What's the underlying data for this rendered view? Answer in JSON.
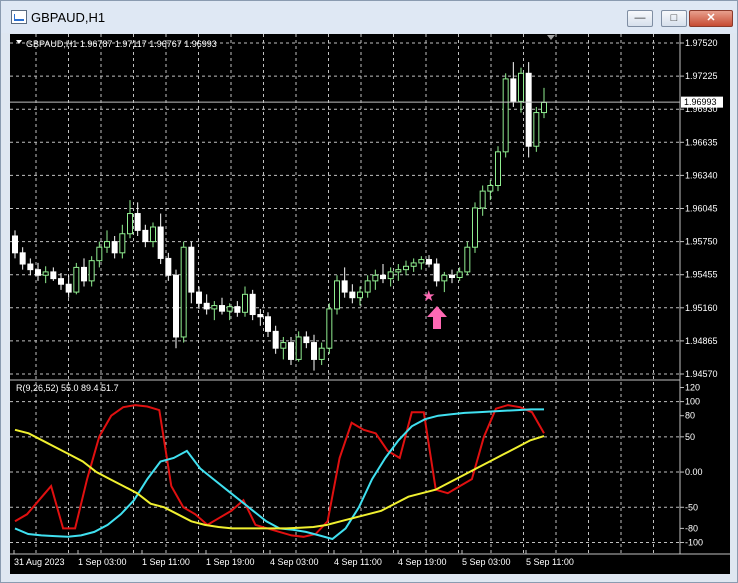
{
  "window": {
    "title": "GBPAUD,H1",
    "minimize_icon": "minimize-icon",
    "maximize_icon": "maximize-icon",
    "close_icon": "close-icon"
  },
  "info": {
    "header": "GBPAUD,H1  1.96787 1.97117 1.96767 1.96993",
    "indicator": "R(9,26,52) 55.0 89.4 51.7",
    "current_price": "1.96993"
  },
  "colors": {
    "background": "#000000",
    "grid": "#c0c0c0",
    "bull": "#90ee90",
    "bear": "#ffffff",
    "red_line": "#e01010",
    "cyan_line": "#40e0f0",
    "yellow_line": "#f0f030",
    "marker": "#ff69b4"
  },
  "chart_data": [
    {
      "type": "candlestick",
      "symbol": "GBPAUD",
      "timeframe": "H1",
      "y_ticks": [
        "1.97520",
        "1.97225",
        "1.96930",
        "1.96635",
        "1.96340",
        "1.96045",
        "1.95750",
        "1.95455",
        "1.95160",
        "1.94865",
        "1.94570"
      ],
      "ylim": [
        1.9457,
        1.9752
      ],
      "x_ticks": [
        "31 Aug 2023",
        "1 Sep 03:00",
        "1 Sep 11:00",
        "1 Sep 19:00",
        "4 Sep 03:00",
        "4 Sep 11:00",
        "4 Sep 19:00",
        "5 Sep 03:00",
        "5 Sep 11:00"
      ],
      "candles": [
        [
          1.958,
          1.9585,
          1.956,
          1.9565
        ],
        [
          1.9565,
          1.957,
          1.955,
          1.9555
        ],
        [
          1.9555,
          1.956,
          1.9545,
          1.955
        ],
        [
          1.955,
          1.9556,
          1.954,
          1.9545
        ],
        [
          1.9545,
          1.9553,
          1.9538,
          1.9548
        ],
        [
          1.9548,
          1.9552,
          1.954,
          1.9542
        ],
        [
          1.9542,
          1.9547,
          1.9532,
          1.9537
        ],
        [
          1.9537,
          1.9545,
          1.9525,
          1.953
        ],
        [
          1.953,
          1.9556,
          1.9528,
          1.9552
        ],
        [
          1.9552,
          1.956,
          1.9535,
          1.954
        ],
        [
          1.954,
          1.9562,
          1.9535,
          1.9558
        ],
        [
          1.9558,
          1.9575,
          1.9552,
          1.957
        ],
        [
          1.957,
          1.9585,
          1.9565,
          1.9575
        ],
        [
          1.9575,
          1.958,
          1.956,
          1.9565
        ],
        [
          1.9565,
          1.959,
          1.956,
          1.9582
        ],
        [
          1.9582,
          1.9612,
          1.9578,
          1.96
        ],
        [
          1.96,
          1.961,
          1.958,
          1.9585
        ],
        [
          1.9585,
          1.959,
          1.957,
          1.9575
        ],
        [
          1.9575,
          1.9592,
          1.957,
          1.9588
        ],
        [
          1.9588,
          1.96,
          1.9555,
          1.956
        ],
        [
          1.956,
          1.9565,
          1.954,
          1.9545
        ],
        [
          1.9545,
          1.955,
          1.948,
          1.949
        ],
        [
          1.949,
          1.9575,
          1.9485,
          1.957
        ],
        [
          1.957,
          1.9575,
          1.952,
          1.953
        ],
        [
          1.953,
          1.9535,
          1.9515,
          1.952
        ],
        [
          1.952,
          1.9528,
          1.951,
          1.9515
        ],
        [
          1.9515,
          1.9522,
          1.9505,
          1.9518
        ],
        [
          1.9518,
          1.9525,
          1.951,
          1.9513
        ],
        [
          1.9513,
          1.952,
          1.9505,
          1.9517
        ],
        [
          1.9517,
          1.9522,
          1.9508,
          1.9512
        ],
        [
          1.9512,
          1.9535,
          1.9508,
          1.9528
        ],
        [
          1.9528,
          1.9532,
          1.9505,
          1.951
        ],
        [
          1.951,
          1.9515,
          1.95,
          1.9508
        ],
        [
          1.9508,
          1.9512,
          1.949,
          1.9495
        ],
        [
          1.9495,
          1.95,
          1.9475,
          1.948
        ],
        [
          1.948,
          1.949,
          1.947,
          1.9485
        ],
        [
          1.9485,
          1.949,
          1.9465,
          1.947
        ],
        [
          1.947,
          1.9495,
          1.9468,
          1.949
        ],
        [
          1.949,
          1.9495,
          1.948,
          1.9485
        ],
        [
          1.9485,
          1.9492,
          1.946,
          1.947
        ],
        [
          1.947,
          1.9485,
          1.9465,
          1.948
        ],
        [
          1.948,
          1.952,
          1.9475,
          1.9515
        ],
        [
          1.9515,
          1.9545,
          1.951,
          1.954
        ],
        [
          1.954,
          1.9552,
          1.9525,
          1.953
        ],
        [
          1.953,
          1.9537,
          1.952,
          1.9525
        ],
        [
          1.9525,
          1.9535,
          1.9518,
          1.953
        ],
        [
          1.953,
          1.9545,
          1.9525,
          1.954
        ],
        [
          1.954,
          1.955,
          1.9532,
          1.9545
        ],
        [
          1.9545,
          1.9555,
          1.9538,
          1.9542
        ],
        [
          1.9542,
          1.9552,
          1.9535,
          1.9548
        ],
        [
          1.9548,
          1.9555,
          1.954,
          1.955
        ],
        [
          1.955,
          1.9558,
          1.9545,
          1.9553
        ],
        [
          1.9553,
          1.956,
          1.9548,
          1.9556
        ],
        [
          1.9556,
          1.9562,
          1.955,
          1.9559
        ],
        [
          1.9559,
          1.9563,
          1.9552,
          1.9555
        ],
        [
          1.9555,
          1.956,
          1.9535,
          1.954
        ],
        [
          1.954,
          1.9548,
          1.953,
          1.9545
        ],
        [
          1.9545,
          1.955,
          1.9538,
          1.9543
        ],
        [
          1.9543,
          1.9552,
          1.954,
          1.9548
        ],
        [
          1.9548,
          1.9575,
          1.9545,
          1.957
        ],
        [
          1.957,
          1.961,
          1.9565,
          1.9605
        ],
        [
          1.9605,
          1.9625,
          1.9598,
          1.962
        ],
        [
          1.962,
          1.963,
          1.9612,
          1.9625
        ],
        [
          1.9625,
          1.966,
          1.962,
          1.9655
        ],
        [
          1.9655,
          1.9725,
          1.965,
          1.972
        ],
        [
          1.972,
          1.9735,
          1.9695,
          1.97
        ],
        [
          1.97,
          1.973,
          1.969,
          1.9725
        ],
        [
          1.9725,
          1.9735,
          1.965,
          1.966
        ],
        [
          1.966,
          1.9695,
          1.9655,
          1.969
        ],
        [
          1.969,
          1.9712,
          1.9685,
          1.9699
        ]
      ]
    },
    {
      "type": "line",
      "name": "R(9,26,52)",
      "y_ticks": [
        "120",
        "100",
        "80",
        "50",
        "0.00",
        "-50",
        "-80",
        "-100"
      ],
      "ylim": [
        -105,
        125
      ],
      "series": [
        {
          "color": "#e01010",
          "values": [
            -70,
            -60,
            -40,
            -20,
            -80,
            -80,
            -10,
            50,
            80,
            92,
            95,
            93,
            88,
            -20,
            -50,
            -60,
            -75,
            -65,
            -55,
            -40,
            -75,
            -80,
            -85,
            -90,
            -92,
            -88,
            -70,
            20,
            70,
            60,
            55,
            30,
            20,
            85,
            85,
            -25,
            -30,
            -20,
            -10,
            50,
            90,
            95,
            92,
            85,
            55
          ]
        },
        {
          "color": "#40e0f0",
          "values": [
            -80,
            -88,
            -90,
            -91,
            -92,
            -90,
            -85,
            -75,
            -60,
            -40,
            -10,
            15,
            20,
            30,
            5,
            -10,
            -25,
            -40,
            -55,
            -70,
            -80,
            -82,
            -85,
            -90,
            -95,
            -80,
            -50,
            -10,
            20,
            45,
            65,
            75,
            80,
            82,
            84,
            85,
            86,
            87,
            88,
            89,
            89
          ]
        },
        {
          "color": "#f0f030",
          "values": [
            60,
            55,
            45,
            35,
            25,
            15,
            0,
            -10,
            -20,
            -30,
            -45,
            -50,
            -60,
            -70,
            -75,
            -78,
            -80,
            -80,
            -80,
            -80,
            -80,
            -79,
            -78,
            -75,
            -70,
            -65,
            -60,
            -55,
            -45,
            -35,
            -30,
            -25,
            -15,
            -5,
            5,
            15,
            25,
            35,
            45,
            51
          ]
        }
      ]
    }
  ]
}
